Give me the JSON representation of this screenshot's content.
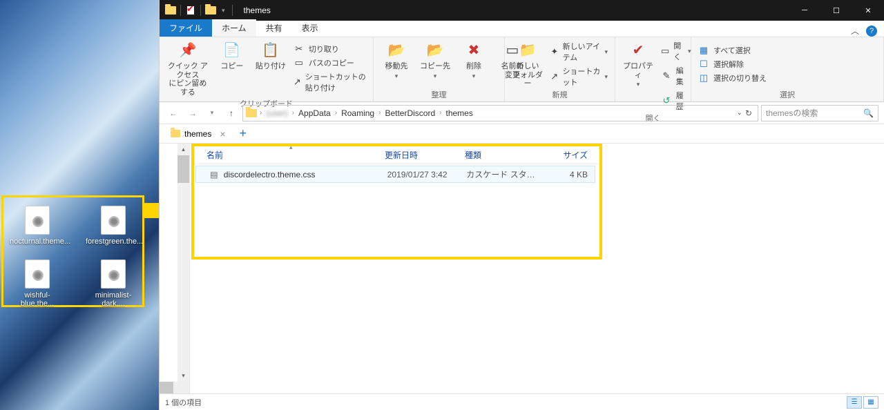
{
  "window": {
    "title": "themes"
  },
  "desktop_icons": [
    {
      "label": "nocturnal.theme..."
    },
    {
      "label": "forestgreen.the..."
    },
    {
      "label": "wishful-blue.the..."
    },
    {
      "label": "minimalist-dark...."
    }
  ],
  "ribbon_tabs": {
    "file": "ファイル",
    "home": "ホーム",
    "share": "共有",
    "view": "表示"
  },
  "ribbon": {
    "pin": "クイック アクセス\nにピン留めする",
    "copy": "コピー",
    "paste": "貼り付け",
    "cut": "切り取り",
    "copypath": "パスのコピー",
    "paste_shortcut": "ショートカットの貼り付け",
    "group_clipboard": "クリップボード",
    "moveto": "移動先",
    "copyto": "コピー先",
    "delete": "削除",
    "rename": "名前の\n変更",
    "group_organize": "整理",
    "newfolder": "新しい\nフォルダー",
    "newitem": "新しいアイテム",
    "shortcut": "ショートカット",
    "group_new": "新規",
    "properties": "プロパティ",
    "open": "開く",
    "edit": "編集",
    "history": "履歴",
    "group_open": "開く",
    "select_all": "すべて選択",
    "select_none": "選択解除",
    "select_invert": "選択の切り替え",
    "group_select": "選択"
  },
  "breadcrumbs": [
    "(user)",
    "AppData",
    "Roaming",
    "BetterDiscord",
    "themes"
  ],
  "search": {
    "placeholder": "themesの検索"
  },
  "folder_tab": "themes",
  "columns": {
    "name": "名前",
    "date": "更新日時",
    "type": "種類",
    "size": "サイズ"
  },
  "files": [
    {
      "name": "discordelectro.theme.css",
      "date": "2019/01/27 3:42",
      "type": "カスケード スタイル シ...",
      "size": "4 KB"
    }
  ],
  "status": "1 個の項目"
}
